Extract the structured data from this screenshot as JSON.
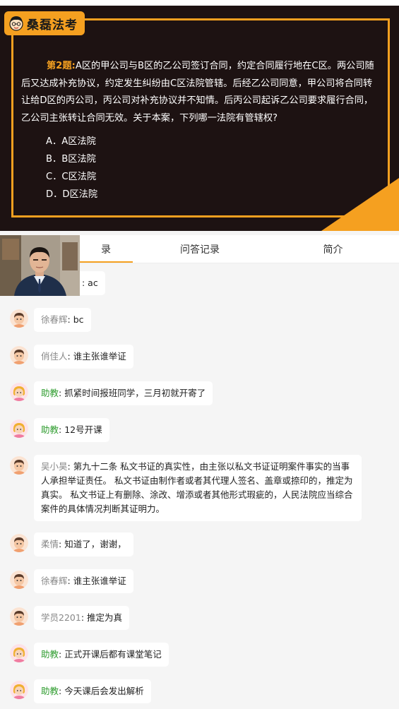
{
  "board": {
    "logo_text": "桑磊法考",
    "question_number": "第2题:",
    "question_text": "A区的甲公司与B区的乙公司签订合同，约定合同履行地在C区。两公司随后又达成补充协议，约定发生纠纷由C区法院管辖。后经乙公司同意，甲公司将合同转让给D区的丙公司，丙公司对补充协议并不知情。后丙公司起诉乙公司要求履行合同，乙公司主张转让合同无效。关于本案，下列哪一法院有管辖权?",
    "options": [
      "A．A区法院",
      "B．B区法院",
      "C．C区法院",
      "D．D区法院"
    ],
    "accent_color": "#f5a020",
    "background_color": "#1d1212"
  },
  "tabs": [
    {
      "label": "录",
      "active": true
    },
    {
      "label": "问答记录",
      "active": false
    },
    {
      "label": "简介",
      "active": false
    }
  ],
  "chat": {
    "messages": [
      {
        "name": "",
        "text": ": ac",
        "avatar": "male",
        "role": "student"
      },
      {
        "name": "徐春辉",
        "text": ": bc",
        "avatar": "male",
        "role": "student"
      },
      {
        "name": "俏佳人",
        "text": ": 谁主张谁举证",
        "avatar": "male",
        "role": "student"
      },
      {
        "name": "助教",
        "text": ": 抓紧时间报班同学，三月初就开寄了",
        "avatar": "female",
        "role": "assistant"
      },
      {
        "name": "助教",
        "text": ": 12号开课",
        "avatar": "female",
        "role": "assistant"
      },
      {
        "name": "吴小昊",
        "text": ": 第九十二条 私文书证的真实性，由主张以私文书证证明案件事实的当事人承担举证责任。 私文书证由制作者或者其代理人签名、盖章或捺印的，推定为真实。 私文书证上有删除、涂改、增添或者其他形式瑕疵的，人民法院应当综合案件的具体情况判断其证明力。",
        "avatar": "male",
        "role": "student"
      },
      {
        "name": "柔情",
        "text": ": 知道了，谢谢，",
        "avatar": "male",
        "role": "student"
      },
      {
        "name": "徐春辉",
        "text": ": 谁主张谁举证",
        "avatar": "male",
        "role": "student"
      },
      {
        "name": "学员2201",
        "text": ": 推定为真",
        "avatar": "male",
        "role": "student"
      },
      {
        "name": "助教",
        "text": ": 正式开课后都有课堂笔记",
        "avatar": "female",
        "role": "assistant"
      },
      {
        "name": "助教",
        "text": ": 今天课后会发出解析",
        "avatar": "female",
        "role": "assistant"
      }
    ],
    "name_color_assistant": "#2e9c2e",
    "name_color_student": "#888888"
  }
}
